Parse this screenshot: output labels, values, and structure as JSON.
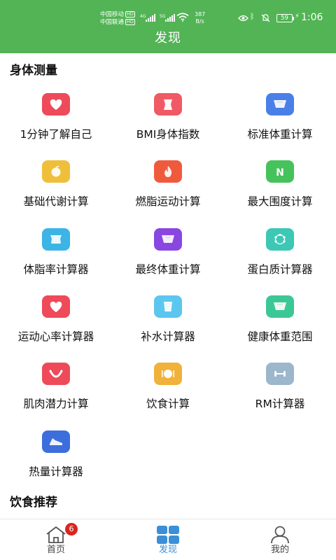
{
  "status_bar": {
    "carrier1": "中国移动",
    "carrier2": "中国联通",
    "hd_label": "HD",
    "net_tag1": "4G",
    "net_tag2": "5G",
    "speed_value": "387",
    "speed_unit": "B/s",
    "battery_level": "59",
    "time": "1:06"
  },
  "header": {
    "title": "发现",
    "color": "#52b455"
  },
  "sections": {
    "body_measure_title": "身体测量",
    "diet_title": "饮食推荐"
  },
  "tools": [
    {
      "label": "1分钟了解自己",
      "icon": "heart-icon",
      "color": "#ee4a5a"
    },
    {
      "label": "BMI身体指数",
      "icon": "waist-icon",
      "color": "#f05a64"
    },
    {
      "label": "标准体重计算",
      "icon": "scale-icon",
      "color": "#4a7fe8"
    },
    {
      "label": "基础代谢计算",
      "icon": "peach-icon",
      "color": "#f0bf3a"
    },
    {
      "label": "燃脂运动计算",
      "icon": "flame-icon",
      "color": "#f05a3c"
    },
    {
      "label": "最大围度计算",
      "icon": "n-letter-icon",
      "color": "#46c25a"
    },
    {
      "label": "体脂率计算器",
      "icon": "torso-icon",
      "color": "#3cb4e6"
    },
    {
      "label": "最终体重计算",
      "icon": "scale-icon",
      "color": "#8a46e0"
    },
    {
      "label": "蛋白质计算器",
      "icon": "molecule-icon",
      "color": "#3cc8b4"
    },
    {
      "label": "运动心率计算器",
      "icon": "heart-icon",
      "color": "#ee4a5a"
    },
    {
      "label": "补水计算器",
      "icon": "cup-icon",
      "color": "#5cc6ef"
    },
    {
      "label": "健康体重范围",
      "icon": "scale-icon",
      "color": "#3cc896"
    },
    {
      "label": "肌肉潜力计算",
      "icon": "bowl-icon",
      "color": "#ee4a5a"
    },
    {
      "label": "饮食计算",
      "icon": "plate-icon",
      "color": "#f0b23a"
    },
    {
      "label": "RM计算器",
      "icon": "dumbbell-icon",
      "color": "#9cb6cc"
    },
    {
      "label": "热量计算器",
      "icon": "shoe-icon",
      "color": "#3c6edc"
    }
  ],
  "bottom_nav": {
    "home_label": "首页",
    "home_badge": "6",
    "discover_label": "发现",
    "mine_label": "我的",
    "active_color": "#3a8fd8"
  }
}
